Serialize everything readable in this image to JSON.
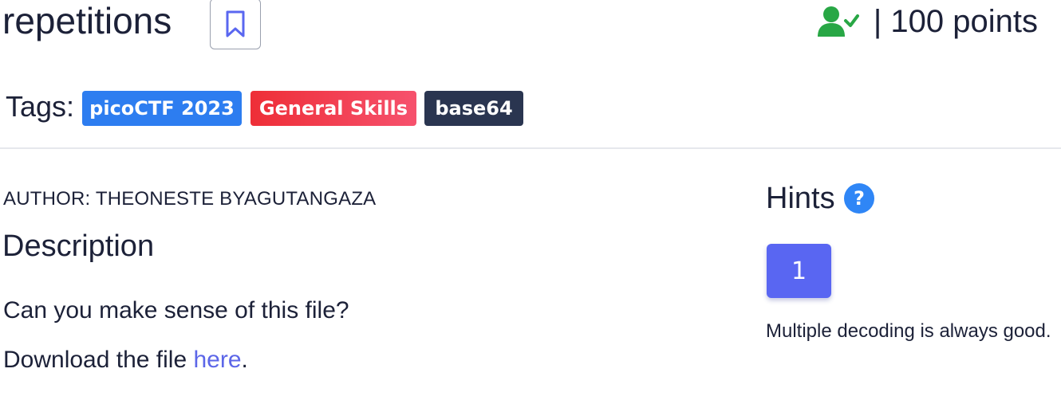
{
  "challenge": {
    "title": "repetitions",
    "points": "| 100 points"
  },
  "tags": {
    "label": "Tags:",
    "items": [
      {
        "label": "picoCTF 2023",
        "color": "#2d7df0"
      },
      {
        "label": "General Skills",
        "color": "#f0363f"
      },
      {
        "label": "base64",
        "color": "#2a3550"
      }
    ]
  },
  "author": "AUTHOR: THEONESTE BYAGUTANGAZA",
  "description": {
    "heading": "Description",
    "line1": "Can you make sense of this file?",
    "line2_prefix": "Download the file ",
    "line2_link": "here",
    "line2_suffix": "."
  },
  "hints": {
    "heading": "Hints",
    "button_label": "1",
    "text": "Multiple decoding is always good."
  },
  "icons": {
    "bookmark": "bookmark-icon",
    "solved": "user-check-icon",
    "help": "question-circle-icon"
  },
  "colors": {
    "text": "#1c2138",
    "accent": "#5966f2",
    "solved_green": "#28a745",
    "help_blue": "#2f86f6",
    "link": "#5c66e8"
  }
}
